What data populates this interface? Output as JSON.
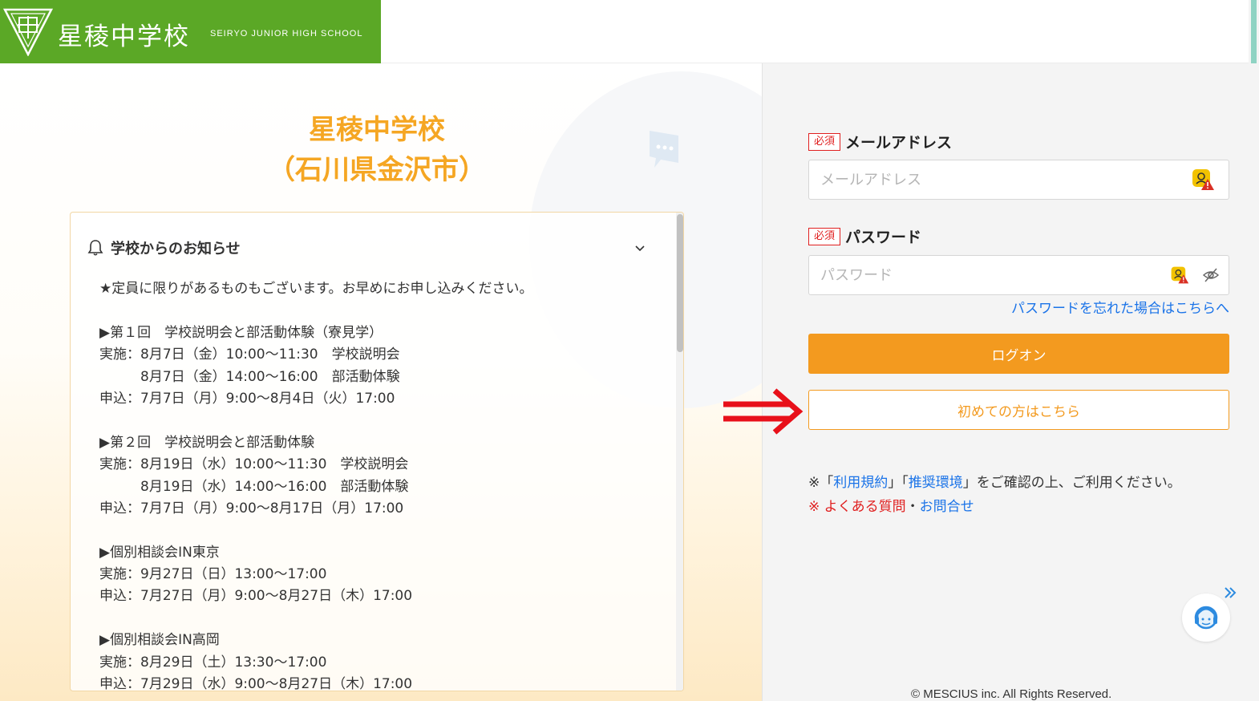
{
  "header": {
    "logo_title": "星稜中学校",
    "logo_subtitle": "SEIRYO JUNIOR HIGH SCHOOL",
    "brand_color": "#5ba826"
  },
  "main": {
    "school_name": "星稜中学校",
    "school_location": "（石川県金沢市）",
    "title_color": "#f5a623"
  },
  "notice": {
    "title": "学校からのお知らせ",
    "lines": [
      "★定員に限りがあるものもございます。お早めにお申し込みください。",
      "",
      "▶第１回　学校説明会と部活動体験（寮見学）",
      "実施：8月7日（金）10:00～11:30　学校説明会",
      "　　　8月7日（金）14:00～16:00　部活動体験",
      "申込：7月7日（月）9:00～8月4日（火）17:00",
      "",
      "▶第２回　学校説明会と部活動体験",
      "実施：8月19日（水）10:00～11:30　学校説明会",
      "　　　8月19日（水）14:00～16:00　部活動体験",
      "申込：7月7日（月）9:00～8月17日（月）17:00",
      "",
      "▶個別相談会IN東京",
      "実施：9月27日（日）13:00～17:00",
      "申込：7月27日（月）9:00～8月27日（木）17:00",
      "",
      "▶個別相談会IN高岡",
      "実施：8月29日（土）13:30～17:00",
      "申込：7月29日（水）9:00～8月27日（木）17:00"
    ]
  },
  "login": {
    "required_badge": "必須",
    "email_label": "メールアドレス",
    "email_placeholder": "メールアドレス",
    "email_value": "",
    "password_label": "パスワード",
    "password_placeholder": "パスワード",
    "password_value": "",
    "forgot_link": "パスワードを忘れた場合はこちらへ",
    "login_button": "ログオン",
    "first_time_button": "初めての方はこちら",
    "accent_color": "#f39a1f"
  },
  "notes": {
    "line1_prefix": "※「",
    "terms_link": "利用規約",
    "line1_mid": "」「",
    "env_link": "推奨環境",
    "line1_suffix": "」をご確認の上、ご利用ください。",
    "line2_prefix": "※ ",
    "faq_link": "よくある質問",
    "separator": "・",
    "contact_link": "お問合せ"
  },
  "footer": {
    "copyright": "© MESCIUS inc. All Rights Reserved."
  },
  "icons": {
    "emblem": "school-emblem-icon",
    "bell": "bell-icon",
    "chevron": "chevron-down-icon",
    "warn": "password-manager-warning-icon",
    "eye": "eye-off-icon",
    "support": "support-agent-icon",
    "collapse": "double-chevron-right-icon"
  }
}
